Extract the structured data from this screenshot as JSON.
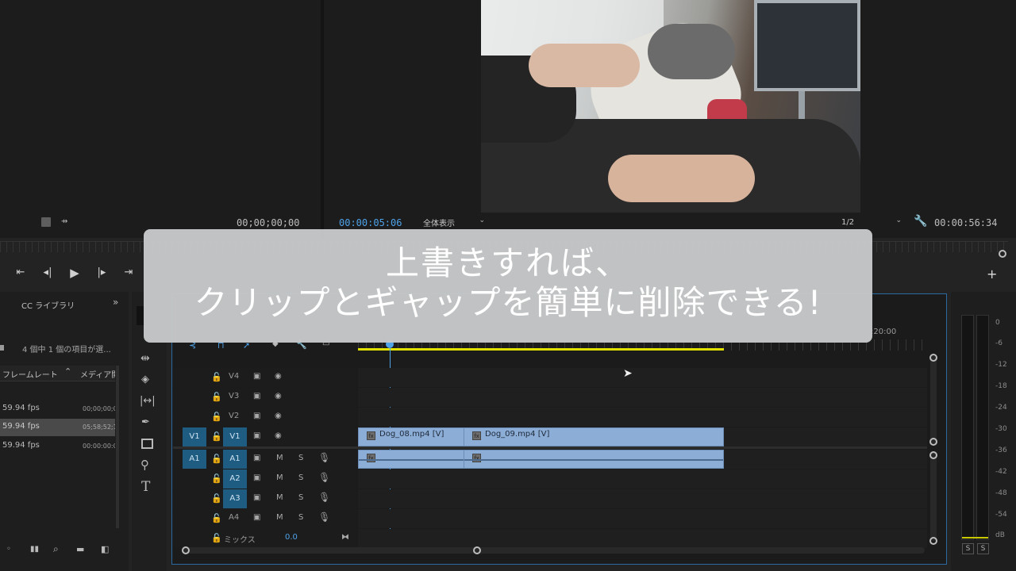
{
  "source_monitor": {
    "timecode": "00;00;00;00"
  },
  "program_monitor": {
    "timecode_current": "00:00:05:06",
    "zoom_label": "全体表示",
    "resolution_label": "1/2",
    "timecode_duration": "00:00:56:34"
  },
  "overlay": {
    "line1": "上書きすれば、",
    "line2": "クリップとギャップを簡単に削除できる!"
  },
  "project_panel": {
    "tab_label": "CC ライブラリ",
    "selection_status": "4 個中 1 個の項目が選...",
    "columns": [
      "フレームレート",
      "メディア開"
    ],
    "rows": [
      {
        "fps": "59.94 fps",
        "tc": "00;00;00;0"
      },
      {
        "fps": "59.94 fps",
        "tc": "05;58;52;1"
      },
      {
        "fps": "59.94 fps",
        "tc": "00:00:00:0"
      }
    ]
  },
  "timeline": {
    "ruler_label": ":20:00",
    "tracks_video": [
      {
        "src": "",
        "name": "V4"
      },
      {
        "src": "",
        "name": "V3"
      },
      {
        "src": "",
        "name": "V2"
      },
      {
        "src": "V1",
        "name": "V1"
      }
    ],
    "tracks_audio": [
      {
        "src": "A1",
        "name": "A1",
        "m": "M",
        "s": "S"
      },
      {
        "src": "",
        "name": "A2",
        "m": "M",
        "s": "S"
      },
      {
        "src": "",
        "name": "A3",
        "m": "M",
        "s": "S"
      },
      {
        "src": "",
        "name": "A4",
        "m": "M",
        "s": "S"
      }
    ],
    "mix_label": "ミックス",
    "mix_value": "0.0",
    "clips": [
      {
        "name": "Dog_08.mp4 [V]"
      },
      {
        "name": "Dog_09.mp4 [V]"
      }
    ]
  },
  "audio_meter": {
    "scale": [
      "0",
      "-6",
      "-12",
      "-18",
      "-24",
      "-30",
      "-36",
      "-42",
      "-48",
      "-54",
      "dB"
    ],
    "solo_labels": [
      "S",
      "S"
    ]
  },
  "colors": {
    "accent_blue": "#4ea2e8",
    "clip_blue": "#8cadd6",
    "target_blue": "#1f5c82",
    "work_area_yellow": "#e0e000"
  }
}
